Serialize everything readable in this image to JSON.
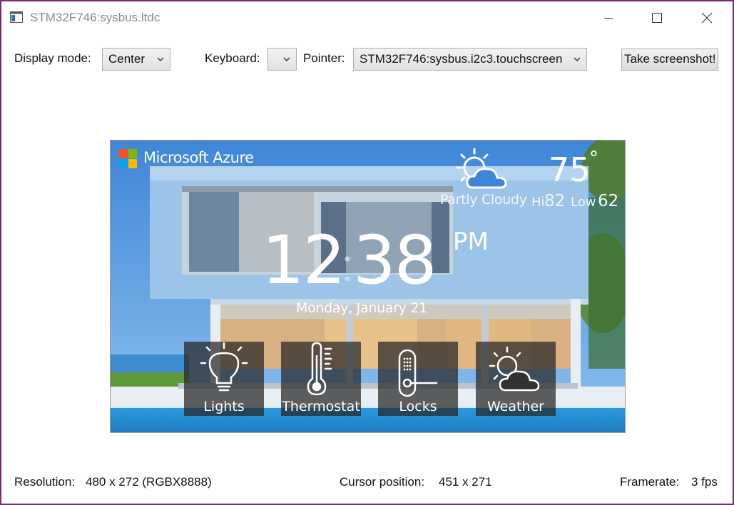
{
  "window": {
    "title": "STM32F746:sysbus.ltdc",
    "controls": {
      "minimize": "minimize-icon",
      "maximize": "maximize-icon",
      "close": "close-icon"
    }
  },
  "toolbar": {
    "display_mode_label": "Display mode:",
    "display_mode_value": "Center",
    "keyboard_label": "Keyboard:",
    "keyboard_value": "",
    "pointer_label": "Pointer:",
    "pointer_value": "STM32F746:sysbus.i2c3.touchscreen",
    "screenshot_button": "Take screenshot!"
  },
  "display": {
    "brand": "Microsoft Azure",
    "brand_logo_colors": [
      "#f25022",
      "#7fba00",
      "#00a4ef",
      "#ffb900"
    ],
    "weather": {
      "temperature": "75",
      "degree_symbol": "°",
      "condition": "Partly Cloudy",
      "hi_label": "Hi",
      "hi_value": "82",
      "low_label": "Low",
      "low_value": "62",
      "icon": "partly-cloudy-icon"
    },
    "clock": {
      "hours": "12",
      "minutes": "38",
      "ampm": "PM"
    },
    "date": "Monday, January 21",
    "tiles": [
      {
        "label": "Lights",
        "icon": "lightbulb-icon"
      },
      {
        "label": "Thermostat",
        "icon": "thermometer-icon"
      },
      {
        "label": "Locks",
        "icon": "door-lock-icon"
      },
      {
        "label": "Weather",
        "icon": "partly-cloudy-icon"
      }
    ]
  },
  "status": {
    "resolution_label": "Resolution:",
    "resolution_value": "480 x 272 (RGBX8888)",
    "cursor_label": "Cursor position:",
    "cursor_value": "451 x 271",
    "framerate_label": "Framerate:",
    "framerate_value": "3 fps"
  }
}
